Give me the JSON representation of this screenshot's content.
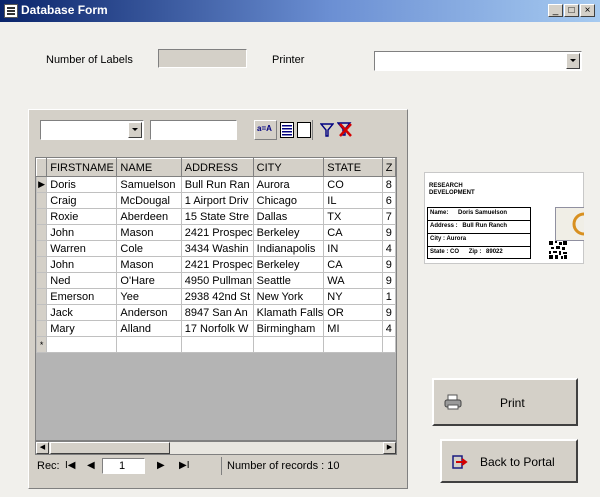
{
  "window": {
    "title": "Database Form",
    "controls": [
      "_",
      "□",
      "×"
    ]
  },
  "header": {
    "num_labels_label": "Number of Labels",
    "num_labels_value": "",
    "printer_label": "Printer",
    "printer_value": ""
  },
  "toolbar": {
    "filter_combo_value": "",
    "find_value": "",
    "sort_icon_text": "a=A"
  },
  "grid": {
    "columns": [
      "FIRSTNAME",
      "NAME",
      "ADDRESS",
      "CITY",
      "STATE",
      "Z"
    ],
    "rows": [
      [
        "Doris",
        "Samuelson",
        "Bull Run Ran",
        "Aurora",
        "CO",
        "8"
      ],
      [
        "Craig",
        "McDougal",
        "1 Airport Driv",
        "Chicago",
        "IL",
        "6"
      ],
      [
        "Roxie",
        "Aberdeen",
        "15 State Stre",
        "Dallas",
        "TX",
        "7"
      ],
      [
        "John",
        "Mason",
        "2421 Prospec",
        "Berkeley",
        "CA",
        "9"
      ],
      [
        "Warren",
        "Cole",
        "3434 Washin",
        "Indianapolis",
        "IN",
        "4"
      ],
      [
        "John",
        "Mason",
        "2421 Prospec",
        "Berkeley",
        "CA",
        "9"
      ],
      [
        "Ned",
        "O'Hare",
        "4950 Pullman",
        "Seattle",
        "WA",
        "9"
      ],
      [
        "Emerson",
        "Yee",
        "2938 42nd St",
        "New York",
        "NY",
        "1"
      ],
      [
        "Jack",
        "Anderson",
        "8947 San An",
        "Klamath Falls",
        "OR",
        "9"
      ],
      [
        "Mary",
        "Alland",
        "17 Norfolk W",
        "Birmingham",
        "MI",
        "4"
      ]
    ],
    "current_marker": "▶",
    "new_row_marker": "*"
  },
  "navigation": {
    "rec_label": "Rec:",
    "current_record": "1",
    "records_text": "Number of records : 10"
  },
  "preview": {
    "logo_line1": "RESEARCH",
    "logo_line2": "DEVELOPMENT",
    "name_label": "Name:",
    "name_value": "Doris Samuelson",
    "address_label": "Address :",
    "address_value": "Bull Run Ranch",
    "city_label": "City :",
    "city_value": "Aurora",
    "state_label": "State : CO",
    "zip_label": "Zip :",
    "zip_value": "89022"
  },
  "buttons": {
    "print_label": "Print",
    "back_label": "Back to Portal"
  }
}
